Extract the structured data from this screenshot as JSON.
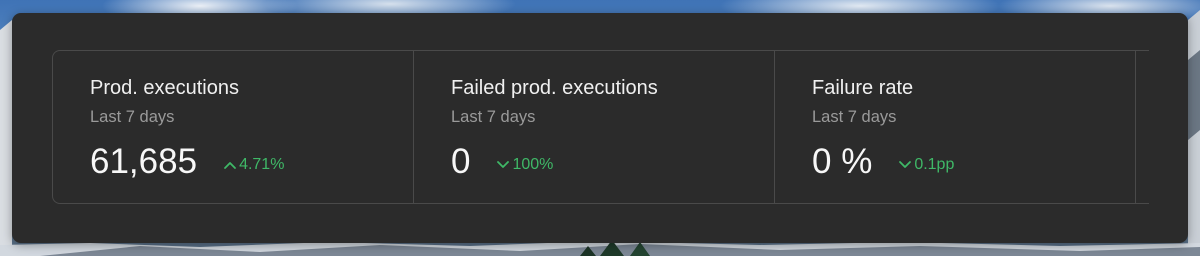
{
  "colors": {
    "panel_bg": "#2b2b2b",
    "border": "#4a4a4a",
    "text_primary": "#f0f0f0",
    "text_secondary": "#9a9a9a",
    "positive_green": "#3fb867"
  },
  "stats": [
    {
      "title": "Prod. executions",
      "period": "Last 7 days",
      "value": "61,685",
      "change": "4.71%",
      "change_direction": "up",
      "change_icon": "chevron-up-icon"
    },
    {
      "title": "Failed prod. executions",
      "period": "Last 7 days",
      "value": "0",
      "change": "100%",
      "change_direction": "down",
      "change_icon": "chevron-down-icon"
    },
    {
      "title": "Failure rate",
      "period": "Last 7 days",
      "value": "0 %",
      "change": "0.1pp",
      "change_direction": "down",
      "change_icon": "chevron-down-icon"
    }
  ]
}
